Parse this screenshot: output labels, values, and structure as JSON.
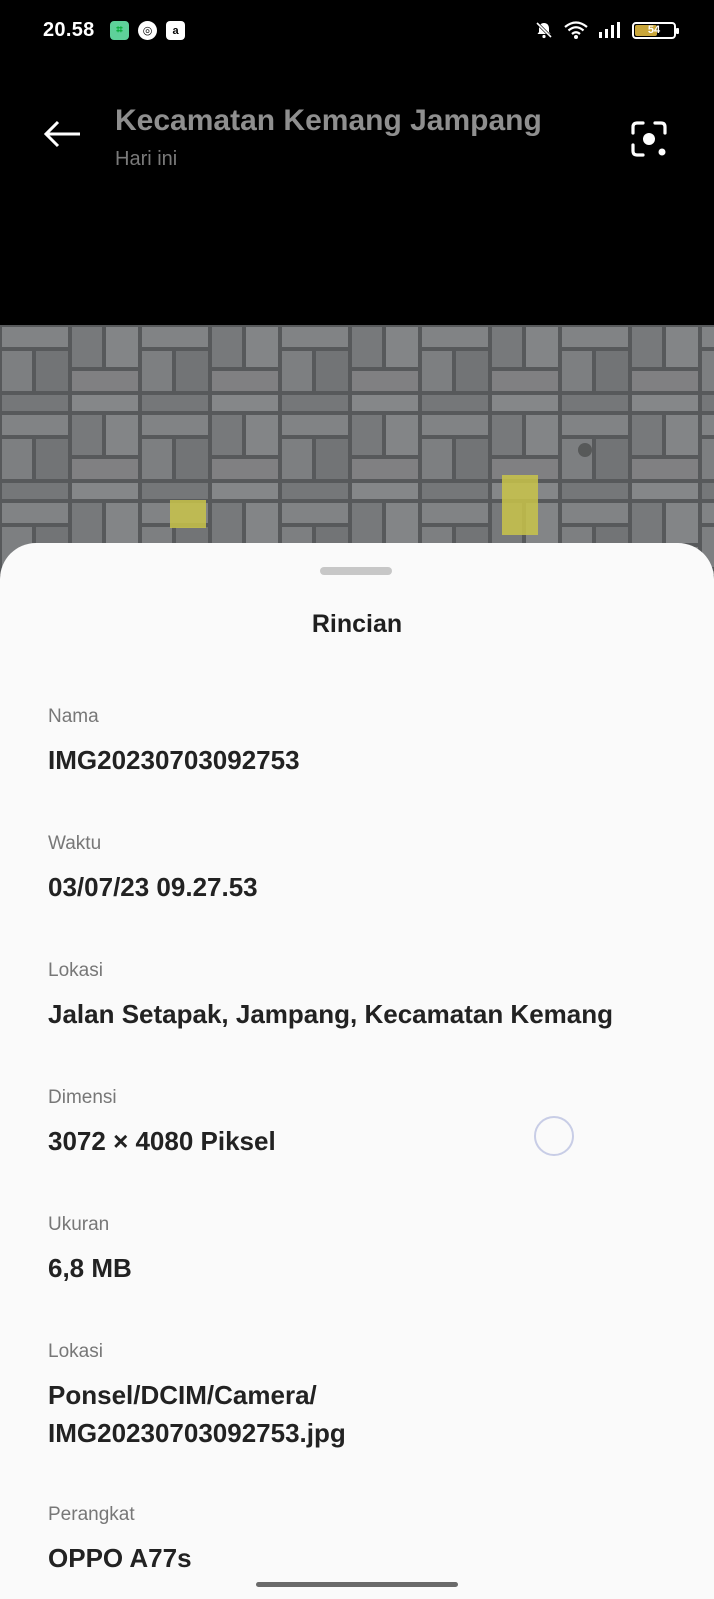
{
  "status_bar": {
    "time": "20.58",
    "notification_icons": [
      "teal-app-icon",
      "chrome-icon",
      "ai-app-icon"
    ],
    "battery_level": "54",
    "battery_percent": 54,
    "system_icons": [
      "mute-icon",
      "wifi-icon",
      "signal-icon",
      "battery-icon"
    ]
  },
  "header": {
    "title": "Kecamatan Kemang Jampang",
    "subtitle": "Hari ini"
  },
  "details": {
    "title": "Rincian",
    "fields": [
      {
        "label": "Nama",
        "value": "IMG20230703092753"
      },
      {
        "label": "Waktu",
        "value": "03/07/23 09.27.53"
      },
      {
        "label": "Lokasi",
        "value": "Jalan Setapak, Jampang, Kecamatan Kemang"
      },
      {
        "label": "Dimensi",
        "value": "3072 × 4080 Piksel"
      },
      {
        "label": "Ukuran",
        "value": "6,8 MB"
      },
      {
        "label": "Lokasi",
        "value_line1": "Ponsel/DCIM/Camera/",
        "value_line2": "IMG20230703092753.jpg"
      },
      {
        "label": "Perangkat",
        "value": "OPPO A77s"
      }
    ]
  },
  "colors": {
    "background_top": "#000000",
    "sheet_background": "#fafafa",
    "title_gray": "#8f8f8f",
    "value_text": "#222222",
    "label_text": "#777777",
    "paving": "#6f7173",
    "yellow_marking": "#c9c44a"
  }
}
